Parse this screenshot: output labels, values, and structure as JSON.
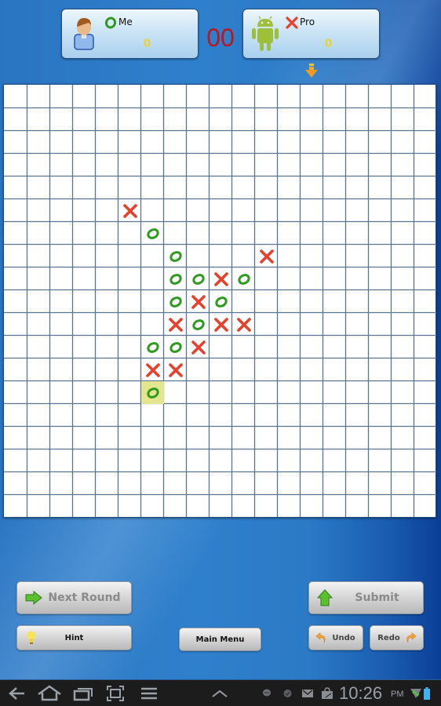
{
  "players": {
    "me": {
      "name": "Me",
      "mark": "O",
      "score": "0",
      "avatar": "person-avatar-icon"
    },
    "pro": {
      "name": "Pro",
      "mark": "X",
      "score": "0",
      "avatar": "android-robot-icon"
    }
  },
  "timer": "00",
  "turn_indicator": "pro",
  "board": {
    "size": 19,
    "pieces": [
      {
        "col": 5,
        "row": 5,
        "mark": "X"
      },
      {
        "col": 6,
        "row": 6,
        "mark": "O"
      },
      {
        "col": 7,
        "row": 7,
        "mark": "O"
      },
      {
        "col": 11,
        "row": 7,
        "mark": "X"
      },
      {
        "col": 7,
        "row": 8,
        "mark": "O"
      },
      {
        "col": 8,
        "row": 8,
        "mark": "O"
      },
      {
        "col": 9,
        "row": 8,
        "mark": "X"
      },
      {
        "col": 10,
        "row": 8,
        "mark": "O"
      },
      {
        "col": 7,
        "row": 9,
        "mark": "O"
      },
      {
        "col": 8,
        "row": 9,
        "mark": "X"
      },
      {
        "col": 9,
        "row": 9,
        "mark": "O"
      },
      {
        "col": 7,
        "row": 10,
        "mark": "X"
      },
      {
        "col": 8,
        "row": 10,
        "mark": "O"
      },
      {
        "col": 9,
        "row": 10,
        "mark": "X"
      },
      {
        "col": 10,
        "row": 10,
        "mark": "X"
      },
      {
        "col": 6,
        "row": 11,
        "mark": "O"
      },
      {
        "col": 7,
        "row": 11,
        "mark": "O"
      },
      {
        "col": 8,
        "row": 11,
        "mark": "X"
      },
      {
        "col": 6,
        "row": 12,
        "mark": "X"
      },
      {
        "col": 7,
        "row": 12,
        "mark": "X"
      },
      {
        "col": 6,
        "row": 13,
        "mark": "O",
        "last_move": true
      }
    ]
  },
  "colors": {
    "o_mark": "#2e9a1e",
    "x_mark": "#e8402a",
    "grid_line": "#5a7590",
    "last_move_highlight": "#e3e58f",
    "timer": "#c0141c",
    "score": "#e8d43a"
  },
  "buttons": {
    "next_round": "Next Round",
    "submit": "Submit",
    "hint": "Hint",
    "main_menu": "Main Menu",
    "undo": "Undo",
    "redo": "Redo"
  },
  "system_bar": {
    "time": "10:26",
    "ampm": "PM",
    "nav_icons": [
      "back-icon",
      "home-icon",
      "recent-apps-icon",
      "screenshot-icon",
      "menu-icon",
      "expand-up-icon"
    ],
    "status_icons": [
      "chat-icon",
      "messenger-icon",
      "gmail-icon",
      "market-icon",
      "wifi-icon",
      "battery-icon"
    ]
  }
}
